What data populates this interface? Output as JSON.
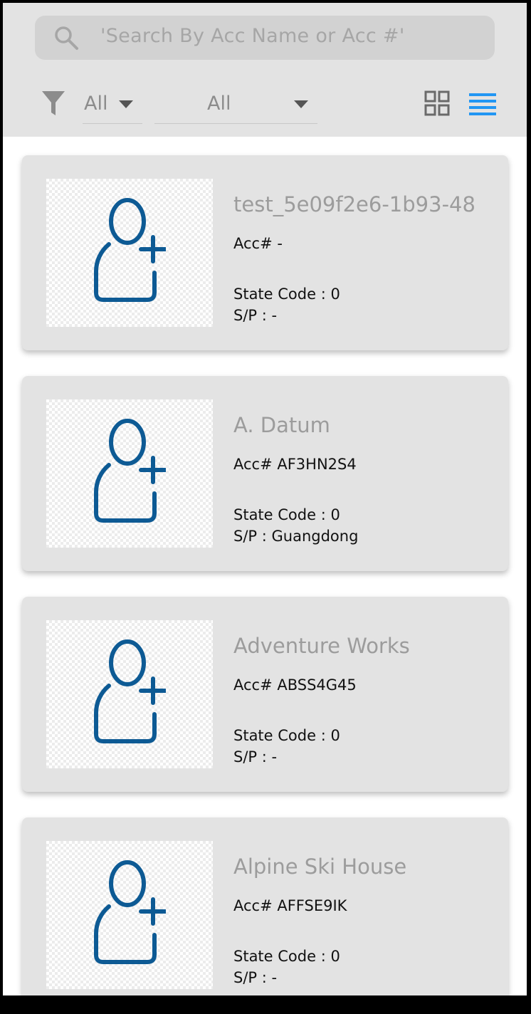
{
  "search": {
    "text": "'Search By Acc Name or Acc #'",
    "icon": "search-icon"
  },
  "filters": {
    "icon": "filter-icon",
    "dropdown1_value": "All",
    "dropdown2_value": "All"
  },
  "view_toggle": {
    "grid_icon": "grid-view-icon",
    "list_icon": "list-view-icon",
    "active": "list",
    "active_color": "#2196f3"
  },
  "accounts": [
    {
      "name": "test_5e09f2e6-1b93-48",
      "acc": "Acc# -",
      "state": "State Code : 0",
      "sp": "S/P : -"
    },
    {
      "name": "A. Datum",
      "acc": "Acc# AF3HN2S4",
      "state": "State Code : 0",
      "sp": "S/P : Guangdong"
    },
    {
      "name": "Adventure Works",
      "acc": "Acc# ABSS4G45",
      "state": "State Code : 0",
      "sp": "S/P : -"
    },
    {
      "name": "Alpine Ski House",
      "acc": "Acc# AFFSE9IK",
      "state": "State Code : 0",
      "sp": "S/P : -"
    }
  ],
  "colors": {
    "avatar_icon": "#0d5a94",
    "header_bg": "#e3e3e3",
    "card_bg": "#e3e3e3"
  }
}
